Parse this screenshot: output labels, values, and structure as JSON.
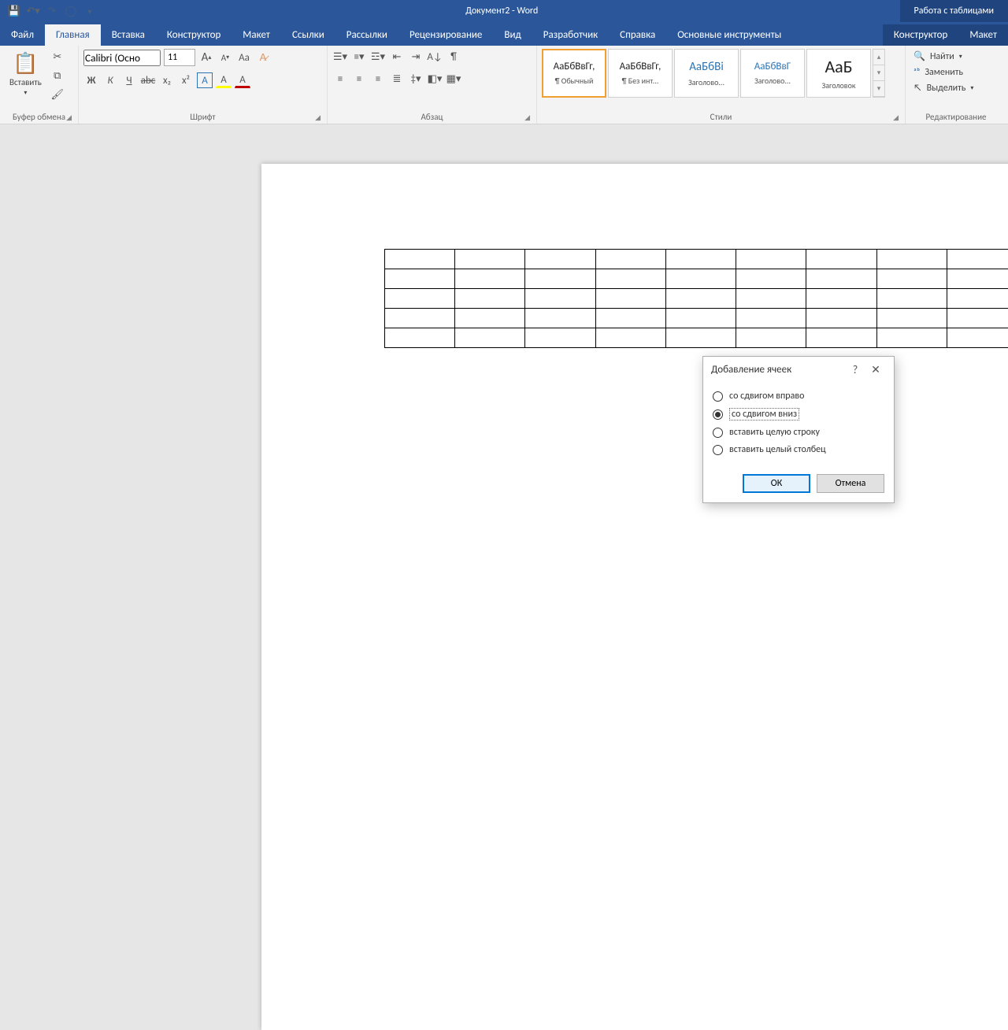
{
  "titlebar": {
    "document_title": "Документ2  -  Word",
    "table_tools": "Работа с таблицами"
  },
  "tabs": {
    "file": "Файл",
    "home": "Главная",
    "insert": "Вставка",
    "design": "Конструктор",
    "layout": "Макет",
    "references": "Ссылки",
    "mailings": "Рассылки",
    "review": "Рецензирование",
    "view": "Вид",
    "developer": "Разработчик",
    "help": "Справка",
    "addins": "Основные инструменты",
    "table_design": "Конструктор",
    "table_layout": "Макет"
  },
  "clipboard": {
    "paste": "Вставить",
    "group": "Буфер обмена"
  },
  "font": {
    "name_value": "Calibri (Осно",
    "size_value": "11",
    "group": "Шрифт",
    "buttons": {
      "bold": "Ж",
      "italic": "К",
      "underline": "Ч",
      "strike": "abc",
      "sub": "x₂",
      "sup": "x²",
      "effects": "A",
      "highlight": "A",
      "color": "A",
      "case": "Aa",
      "clear": "✎",
      "grow": "A",
      "shrink": "A"
    }
  },
  "paragraph": {
    "group": "Абзац"
  },
  "styles": {
    "group": "Стили",
    "items": [
      {
        "preview": "АаБбВвГг,",
        "label": "¶ Обычный"
      },
      {
        "preview": "АаБбВвГг,",
        "label": "¶ Без инт..."
      },
      {
        "preview": "АаБбВі",
        "label": "Заголово..."
      },
      {
        "preview": "АаБбВвГ",
        "label": "Заголово..."
      },
      {
        "preview": "АаБ",
        "label": "Заголовок"
      }
    ]
  },
  "editing": {
    "find": "Найти",
    "replace": "Заменить",
    "select": "Выделить",
    "group": "Редактирование"
  },
  "dialog": {
    "title": "Добавление ячеек",
    "options": {
      "shift_right": "со сдвигом вправо",
      "shift_down": "со сдвигом вниз",
      "insert_row": "вставить целую строку",
      "insert_col": "вставить целый столбец"
    },
    "ok": "ОК",
    "cancel": "Отмена"
  },
  "table": {
    "rows": 5,
    "cols": 9
  }
}
